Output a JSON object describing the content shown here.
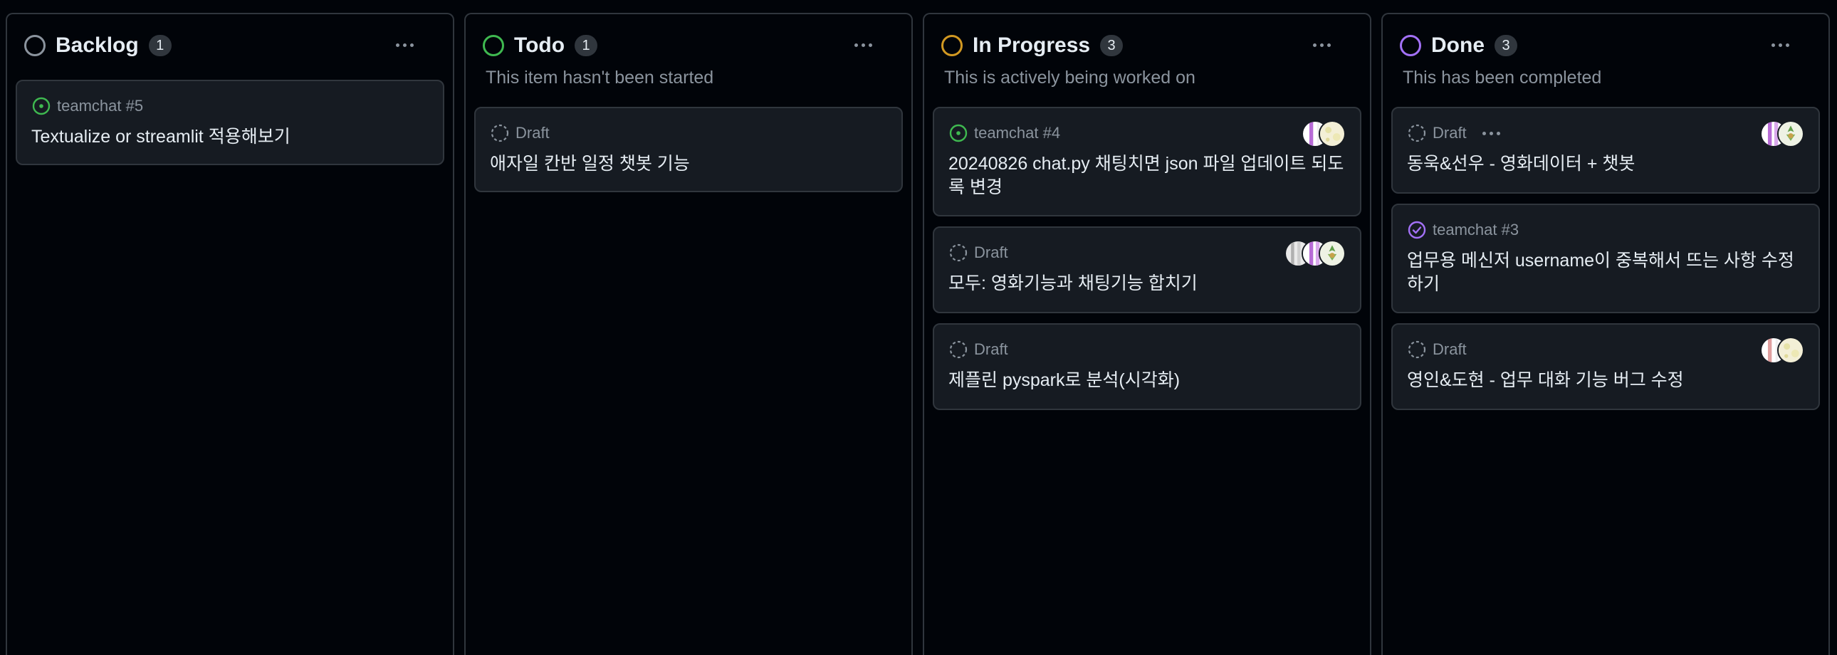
{
  "colors": {
    "background": "#010409",
    "column_border": "#30363d",
    "card_bg": "#161b22",
    "text_primary": "#e6edf3",
    "text_muted": "#8b949e",
    "backlog": "#8b949e",
    "todo": "#3fb950",
    "in_progress": "#d29922",
    "done": "#a371f7"
  },
  "columns": [
    {
      "title": "Backlog",
      "count": "1",
      "status_icon": "gray-circle-icon",
      "description": "",
      "cards": [
        {
          "meta": "teamchat #5",
          "title": "Textualize or streamlit 적용해보기",
          "icon": "open-issue-icon"
        }
      ]
    },
    {
      "title": "Todo",
      "count": "1",
      "status_icon": "green-circle-icon",
      "description": "This item hasn't been started",
      "cards": [
        {
          "meta": "Draft",
          "title": "애자일 칸반 일정 챗봇 기능",
          "icon": "draft-icon"
        }
      ]
    },
    {
      "title": "In Progress",
      "count": "3",
      "status_icon": "orange-circle-icon",
      "description": "This is actively being worked on",
      "cards": [
        {
          "meta": "teamchat #4",
          "title": "20240826 chat.py 채팅치면 json 파일 업데이트 되도록 변경",
          "icon": "open-issue-icon"
        },
        {
          "meta": "Draft",
          "title": "모두: 영화기능과 채팅기능 합치기",
          "icon": "draft-icon"
        },
        {
          "meta": "Draft",
          "title": "제플린 pyspark로 분석(시각화)",
          "icon": "draft-icon"
        }
      ]
    },
    {
      "title": "Done",
      "count": "3",
      "status_icon": "purple-circle-icon",
      "description": "This has been completed",
      "cards": [
        {
          "meta": "Draft",
          "title": "동욱&선우 - 영화데이터 + 챗봇",
          "icon": "draft-icon"
        },
        {
          "meta": "teamchat #3",
          "title": "업무용 메신저 username이 중복해서 뜨는 사항 수정하기",
          "icon": "closed-issue-icon"
        },
        {
          "meta": "Draft",
          "title": "영인&도현 - 업무 대화 기능 버그 수정",
          "icon": "draft-icon"
        }
      ]
    }
  ]
}
